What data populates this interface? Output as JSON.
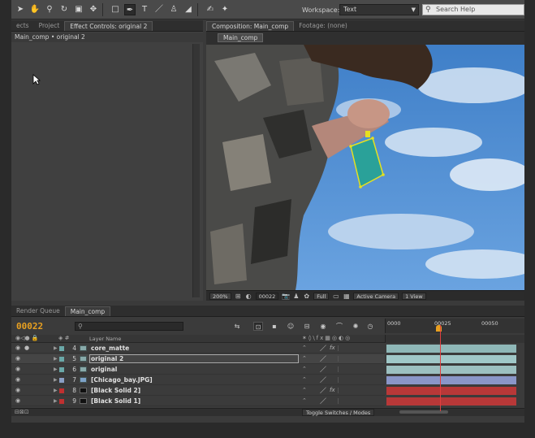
{
  "toolbar": {
    "workspace_label": "Workspace:",
    "workspace_value": "Text",
    "search_placeholder": "Search Help"
  },
  "left_panel": {
    "tabs": [
      {
        "label": "ects"
      },
      {
        "label": "Project"
      },
      {
        "label": "Effect Controls: original 2"
      }
    ],
    "breadcrumb": "Main_comp • original 2"
  },
  "comp_panel": {
    "tabs": [
      {
        "label": "Composition: Main_comp"
      },
      {
        "label": "Footage: (none)"
      }
    ],
    "subtab": "Main_comp",
    "footer": {
      "zoom": "200%",
      "timecode": "00022",
      "resolution": "Full",
      "camera": "Active Camera",
      "views": "1 View"
    }
  },
  "timeline": {
    "tabs": [
      {
        "label": "Render Queue"
      },
      {
        "label": "Main_comp"
      }
    ],
    "current_time": "00022",
    "search_placeholder": "",
    "column_layer_name": "Layer Name",
    "ruler_labels": [
      "0000",
      "00025",
      "00050"
    ],
    "toggle_label": "Toggle Switches / Modes",
    "layers": [
      {
        "num": "4",
        "name": "core_matte",
        "color": "#6aa8a8",
        "track_color": "#8fb8b8",
        "fx": true
      },
      {
        "num": "5",
        "name": "original 2",
        "color": "#6aa8a8",
        "track_color": "#a0c8c8",
        "fx": false,
        "selected": true
      },
      {
        "num": "6",
        "name": "original",
        "color": "#6aa8a8",
        "track_color": "#9cc0c0",
        "fx": false
      },
      {
        "num": "7",
        "name": "[Chicago_bay.JPG]",
        "color": "#8a9fc4",
        "track_color": "#8a96c8",
        "fx": false
      },
      {
        "num": "8",
        "name": "[Black Solid 2]",
        "color": "#c03030",
        "track_color": "#b83838",
        "fx": true
      },
      {
        "num": "9",
        "name": "[Black Solid 1]",
        "color": "#c03030",
        "track_color": "#b83838",
        "fx": false
      }
    ]
  }
}
